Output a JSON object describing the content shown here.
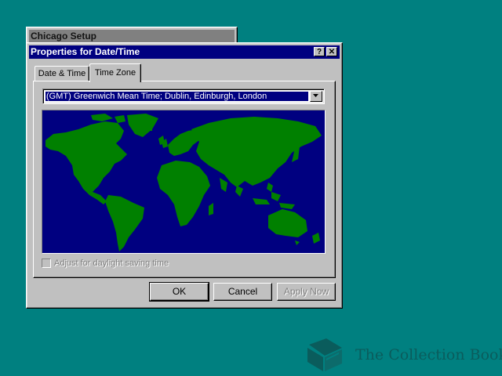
{
  "background_window": {
    "title": "Chicago Setup"
  },
  "dialog": {
    "title": "Properties for Date/Time",
    "help_glyph": "?",
    "close_glyph": "✕",
    "tabs": [
      {
        "label": "Date & Time",
        "active": false
      },
      {
        "label": "Time Zone",
        "active": true
      }
    ],
    "timezone": {
      "selected": "(GMT) Greenwich Mean Time; Dublin, Edinburgh, London"
    },
    "map": {
      "ocean_color": "#000080",
      "land_color": "#008000"
    },
    "dst_checkbox": {
      "label": "Adjust for daylight saving time",
      "checked": false,
      "enabled": false
    },
    "buttons": {
      "ok": "OK",
      "cancel": "Cancel",
      "apply": "Apply Now"
    }
  },
  "watermark": {
    "text": "The Collection Book",
    "icon": "book-icon"
  },
  "colors": {
    "desktop": "#008080",
    "title_active": "#000080",
    "title_inactive": "#808080",
    "face": "#c0c0c0"
  }
}
